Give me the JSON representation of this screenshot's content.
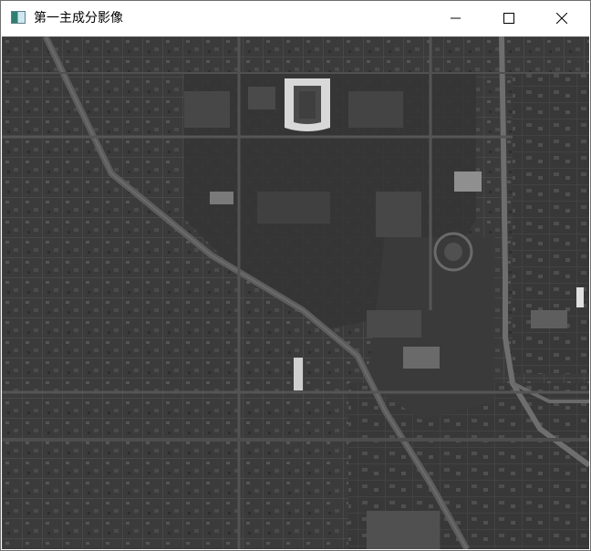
{
  "window": {
    "title": "第一主成分影像",
    "icon": "image-window-icon",
    "controls": {
      "minimize_icon": "minimize-icon",
      "maximize_icon": "maximize-icon",
      "close_icon": "close-icon"
    }
  },
  "image": {
    "description_icon": "grayscale-aerial-image",
    "colors": {
      "background": "#3e3e3e",
      "roads": "#5a5a5a",
      "highway": "#7a7a7a",
      "stadium": "#d8d8d8",
      "buildings": "#8a8a8a"
    }
  }
}
